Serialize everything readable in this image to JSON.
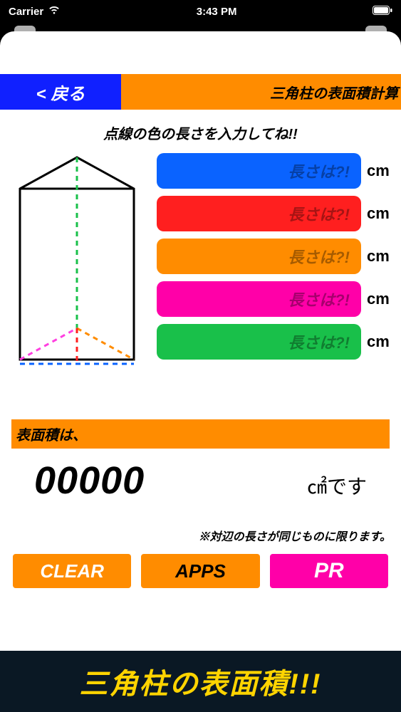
{
  "status": {
    "carrier": "Carrier",
    "time": "3:43 PM"
  },
  "header": {
    "back": "< 戻る",
    "title": "三角柱の表面積計算"
  },
  "instruction": "点線の色の長さを入力してね!!",
  "inputs": {
    "placeholder": "長さは?!",
    "unit": "cm",
    "fields": [
      {
        "color": "blue"
      },
      {
        "color": "red"
      },
      {
        "color": "orange"
      },
      {
        "color": "pink"
      },
      {
        "color": "green"
      }
    ]
  },
  "result": {
    "label": "表面積は、",
    "value": "00000",
    "unit": "㎠です"
  },
  "note": "※対辺の長さが同じものに限ります。",
  "buttons": {
    "clear": "CLEAR",
    "apps": "APPS",
    "pr": "PR"
  },
  "banner": "三角柱の表面積!!!"
}
